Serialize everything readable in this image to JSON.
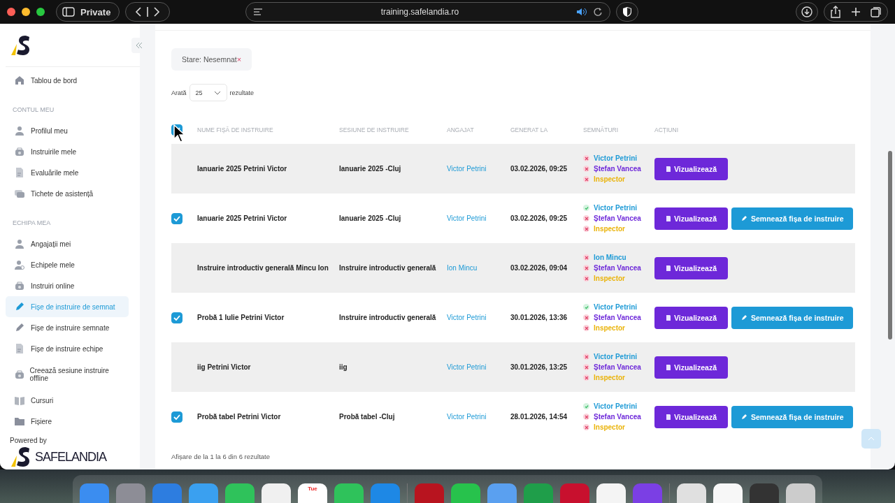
{
  "browser": {
    "private_label": "Private",
    "url": "training.safelandia.ro"
  },
  "sidebar": {
    "items": [
      {
        "kind": "link",
        "label": "Tablou de bord",
        "selected": false
      },
      {
        "kind": "section",
        "label": "CONTUL MEU"
      },
      {
        "kind": "link",
        "label": "Profilul meu",
        "selected": false
      },
      {
        "kind": "link",
        "label": "Instruirile mele",
        "selected": false
      },
      {
        "kind": "link",
        "label": "Evaluările mele",
        "selected": false
      },
      {
        "kind": "link",
        "label": "Tichete de asistență",
        "selected": false
      },
      {
        "kind": "section",
        "label": "ECHIPA MEA"
      },
      {
        "kind": "link",
        "label": "Angajații mei",
        "selected": false
      },
      {
        "kind": "link",
        "label": "Echipele mele",
        "selected": false
      },
      {
        "kind": "link",
        "label": "Instruiri online",
        "selected": false
      },
      {
        "kind": "link",
        "label": "Fișe de instruire de semnat",
        "selected": true
      },
      {
        "kind": "link",
        "label": "Fișe de instruire semnate",
        "selected": false
      },
      {
        "kind": "link",
        "label": "Fișe de instruire echipe",
        "selected": false
      },
      {
        "kind": "link",
        "label": "Creează sesiune instruire offline",
        "selected": false
      },
      {
        "kind": "link",
        "label": "Cursuri",
        "selected": false
      },
      {
        "kind": "link",
        "label": "Fișiere",
        "selected": false
      }
    ],
    "powered_by": "Powered by",
    "brand": "SAFELANDIA"
  },
  "filter_chip": {
    "label": "Stare: Nesemnat",
    "remove": "×"
  },
  "page_size": {
    "prefix": "Arată",
    "value": "25",
    "suffix": "rezultate"
  },
  "table": {
    "select_all_checked": true,
    "columns": [
      "NUME FIȘĂ DE INSTRUIRE",
      "SESIUNE DE INSTRUIRE",
      "ANGAJAT",
      "GENERAT LA",
      "SEMNĂTURI",
      "ACȚIUNI"
    ],
    "rows": [
      {
        "selectable": false,
        "name": "Ianuarie 2025 Petrini Victor",
        "session": "Ianuarie 2025 -Cluj",
        "employee": "Victor Petrini",
        "generated": "03.02.2026, 09:25",
        "signatures": [
          {
            "name": "Victor Petrini",
            "signed": false,
            "color": "#1d9ad6"
          },
          {
            "name": "Ștefan Vancea",
            "signed": false,
            "color": "#6d28d9"
          },
          {
            "name": "Inspector",
            "signed": false,
            "color": "#eab308"
          }
        ],
        "actions": [
          {
            "kind": "view",
            "label": "Vizualizează"
          }
        ]
      },
      {
        "selectable": true,
        "checked": true,
        "name": "Ianuarie 2025 Petrini Victor",
        "session": "Ianuarie 2025 -Cluj",
        "employee": "Victor Petrini",
        "generated": "03.02.2026, 09:25",
        "signatures": [
          {
            "name": "Victor Petrini",
            "signed": true,
            "color": "#1d9ad6"
          },
          {
            "name": "Ștefan Vancea",
            "signed": false,
            "color": "#6d28d9"
          },
          {
            "name": "Inspector",
            "signed": false,
            "color": "#eab308"
          }
        ],
        "actions": [
          {
            "kind": "view",
            "label": "Vizualizează"
          },
          {
            "kind": "sign",
            "label": "Semnează fișa de instruire"
          }
        ]
      },
      {
        "selectable": false,
        "name": "Instruire introductiv generală Mincu Ion",
        "session": "Instruire introductiv generală",
        "employee": "Ion Mincu",
        "generated": "03.02.2026, 09:04",
        "signatures": [
          {
            "name": "Ion Mincu",
            "signed": false,
            "color": "#1d9ad6"
          },
          {
            "name": "Ștefan Vancea",
            "signed": false,
            "color": "#6d28d9"
          },
          {
            "name": "Inspector",
            "signed": false,
            "color": "#eab308"
          }
        ],
        "actions": [
          {
            "kind": "view",
            "label": "Vizualizează"
          }
        ]
      },
      {
        "selectable": true,
        "checked": true,
        "name": "Probă 1 Iulie Petrini Victor",
        "session": "Instruire introductiv generală",
        "employee": "Victor Petrini",
        "generated": "30.01.2026, 13:36",
        "signatures": [
          {
            "name": "Victor Petrini",
            "signed": true,
            "color": "#1d9ad6"
          },
          {
            "name": "Ștefan Vancea",
            "signed": false,
            "color": "#6d28d9"
          },
          {
            "name": "Inspector",
            "signed": false,
            "color": "#eab308"
          }
        ],
        "actions": [
          {
            "kind": "view",
            "label": "Vizualizează"
          },
          {
            "kind": "sign",
            "label": "Semnează fișa de instruire"
          }
        ]
      },
      {
        "selectable": false,
        "name": "iig Petrini Victor",
        "session": "iig",
        "employee": "Victor Petrini",
        "generated": "30.01.2026, 13:25",
        "signatures": [
          {
            "name": "Victor Petrini",
            "signed": false,
            "color": "#1d9ad6"
          },
          {
            "name": "Ștefan Vancea",
            "signed": false,
            "color": "#6d28d9"
          },
          {
            "name": "Inspector",
            "signed": false,
            "color": "#eab308"
          }
        ],
        "actions": [
          {
            "kind": "view",
            "label": "Vizualizează"
          }
        ]
      },
      {
        "selectable": true,
        "checked": true,
        "name": "Probă tabel Petrini Victor",
        "session": "Probă tabel -Cluj",
        "employee": "Victor Petrini",
        "generated": "28.01.2026, 14:54",
        "signatures": [
          {
            "name": "Victor Petrini",
            "signed": true,
            "color": "#1d9ad6"
          },
          {
            "name": "Ștefan Vancea",
            "signed": false,
            "color": "#6d28d9"
          },
          {
            "name": "Inspector",
            "signed": false,
            "color": "#eab308"
          }
        ],
        "actions": [
          {
            "kind": "view",
            "label": "Vizualizează"
          },
          {
            "kind": "sign",
            "label": "Semnează fișa de instruire"
          }
        ]
      }
    ]
  },
  "footer": "Afișare de la 1 la 6 din 6 rezultate",
  "dock": {
    "calendar_day": "Tue"
  }
}
